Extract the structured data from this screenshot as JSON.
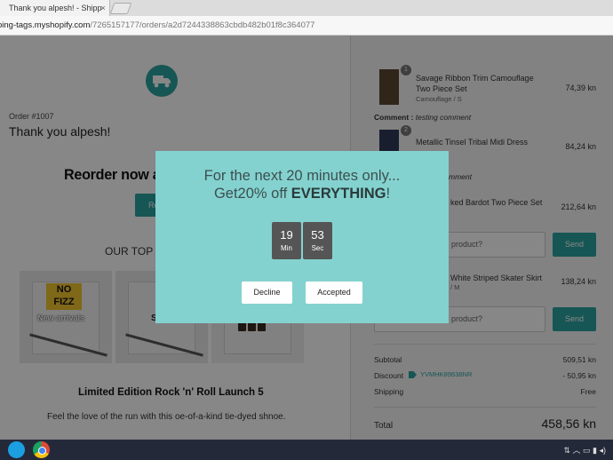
{
  "browser": {
    "tab_title": "Thank you alpesh! - Shipp",
    "tab_close": "×",
    "url_host": "ping-tags.myshopify.com",
    "url_path": "/7265157177/orders/a2d7244338863cbdb482b01f8c364077"
  },
  "page": {
    "order_number": "Order #1007",
    "thanks": "Thank you alpesh!",
    "reorder_title": "Reorder now a",
    "reorder_button": "Re",
    "top_heading": "OUR TOP C",
    "tiles": [
      {
        "label": "New arrivals",
        "logo": "NO FIZZ"
      },
      {
        "label": "S"
      },
      {
        "label": ""
      }
    ],
    "product_title": "Limited Edition Rock 'n' Roll Launch 5",
    "product_desc": "Feel the love of the run with this oe-of-a-kind tie-dyed shnoe."
  },
  "order": {
    "items": [
      {
        "badge": "1",
        "name_line1": "Savage Ribbon Trim Camouflage",
        "name_line2": "Two Piece Set",
        "variant": "Camouflage / S",
        "price": "74,39 kn"
      },
      {
        "badge": "2",
        "name_line1": "Metallic Tinsel Tribal Midi Dress",
        "name_line2": "",
        "variant": "",
        "price": "84,24 kn"
      },
      {
        "badge": "",
        "name_line1": "ked Bardot Two Piece Set",
        "name_line2": "",
        "variant": "",
        "price": "212,64 kn"
      },
      {
        "badge": "",
        "name_line1": "White Striped Skater Skirt",
        "name_line2": "",
        "variant": "/ M",
        "price": "138,24 kn"
      }
    ],
    "comment1_label": "Comment :",
    "comment1_text": "testing comment",
    "comment2_text": "mment",
    "question_placeholder": "product?",
    "send_label": "Send",
    "subtotal_label": "Subtotal",
    "subtotal_value": "509,51 kn",
    "discount_label": "Discount",
    "discount_code": "YVMHK89638NR",
    "discount_value": "- 50,95 kn",
    "shipping_label": "Shipping",
    "shipping_value": "Free",
    "total_label": "Total",
    "total_value": "458,56 kn"
  },
  "modal": {
    "line1": "For the next 20 minutes only...",
    "line2_prefix": "Get20% off ",
    "line2_bold": "EVERYTHING",
    "line2_suffix": "!",
    "minutes": "19",
    "minutes_unit": "Min",
    "seconds": "53",
    "seconds_unit": "Sec",
    "decline_label": "Decline",
    "accept_label": "Accepted",
    "background_color": "#84d2cf"
  },
  "colors": {
    "accent": "#2aa2a0",
    "timer_box": "#555555"
  }
}
